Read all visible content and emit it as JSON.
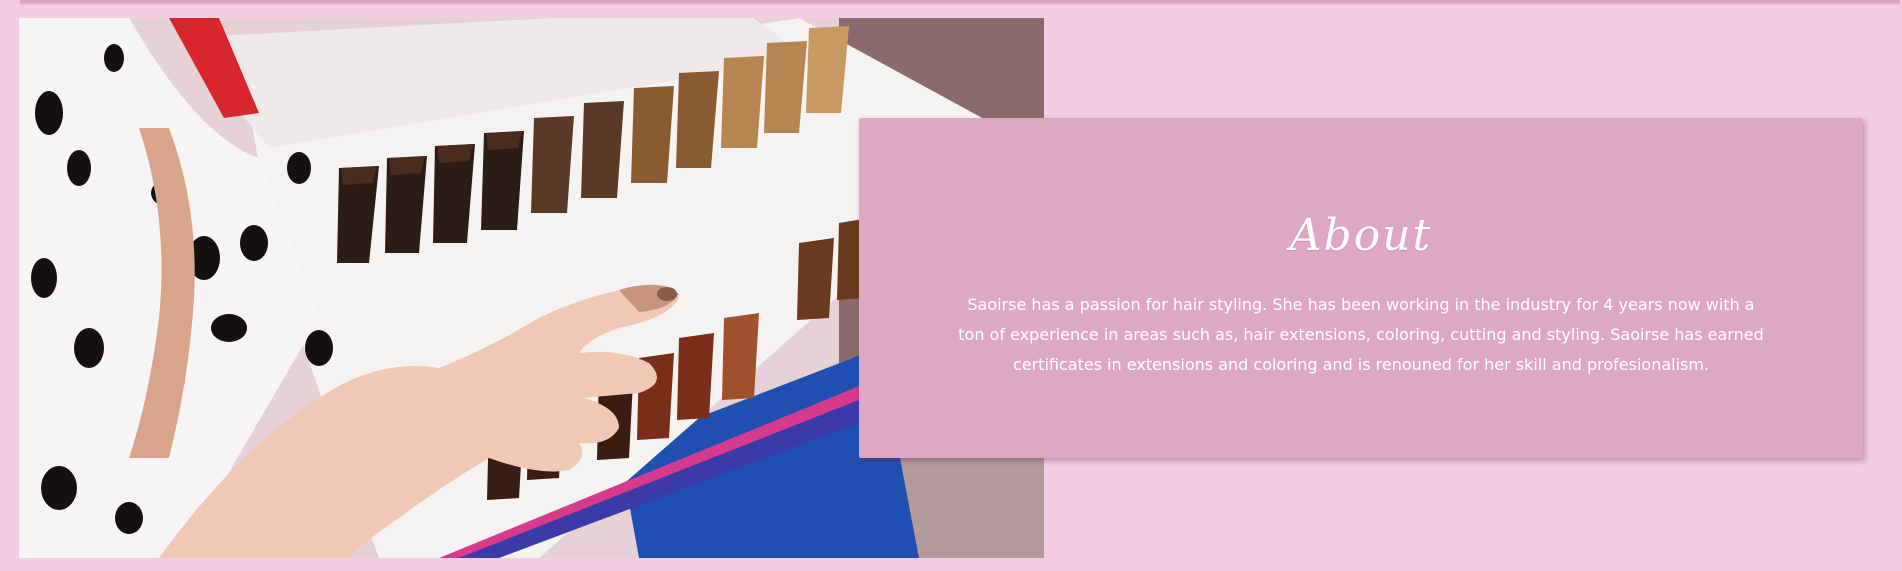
{
  "about": {
    "title": "About",
    "body": "Saoirse has a passion for hair styling. She has been working in the industry for 4 years now with a ton of experience in areas such as, hair extensions, coloring, cutting and styling. Saoirse has earned certificates in extensions and coloring and is renouned for her skill and profesionalism."
  },
  "photo": {
    "subject": "hand-pointing-at-hair-color-swatch-book"
  },
  "colors": {
    "page_background": "#f4cce3",
    "card_background": "#dca8c6",
    "text": "#ffffff"
  }
}
